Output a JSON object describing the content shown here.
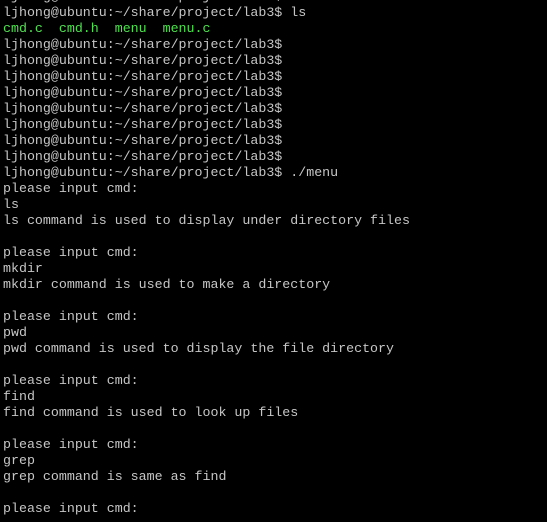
{
  "terminal": {
    "colors": {
      "background": "#000000",
      "text": "#c6c6c6",
      "file_listing": "#4ee04e"
    },
    "lines": [
      {
        "text": "ljhong@ubuntu:~/share/project/lab3$",
        "style": "normal"
      },
      {
        "text": "ljhong@ubuntu:~/share/project/lab3$ ls",
        "style": "normal"
      },
      {
        "text": "cmd.c  cmd.h  menu  menu.c",
        "style": "listing"
      },
      {
        "text": "ljhong@ubuntu:~/share/project/lab3$",
        "style": "normal"
      },
      {
        "text": "ljhong@ubuntu:~/share/project/lab3$",
        "style": "normal"
      },
      {
        "text": "ljhong@ubuntu:~/share/project/lab3$",
        "style": "normal"
      },
      {
        "text": "ljhong@ubuntu:~/share/project/lab3$",
        "style": "normal"
      },
      {
        "text": "ljhong@ubuntu:~/share/project/lab3$",
        "style": "normal"
      },
      {
        "text": "ljhong@ubuntu:~/share/project/lab3$",
        "style": "normal"
      },
      {
        "text": "ljhong@ubuntu:~/share/project/lab3$",
        "style": "normal"
      },
      {
        "text": "ljhong@ubuntu:~/share/project/lab3$",
        "style": "normal"
      },
      {
        "text": "ljhong@ubuntu:~/share/project/lab3$ ./menu",
        "style": "normal"
      },
      {
        "text": "please input cmd:",
        "style": "normal"
      },
      {
        "text": "ls",
        "style": "normal"
      },
      {
        "text": "ls command is used to display under directory files",
        "style": "normal"
      },
      {
        "text": "",
        "style": "normal"
      },
      {
        "text": "please input cmd:",
        "style": "normal"
      },
      {
        "text": "mkdir",
        "style": "normal"
      },
      {
        "text": "mkdir command is used to make a directory",
        "style": "normal"
      },
      {
        "text": "",
        "style": "normal"
      },
      {
        "text": "please input cmd:",
        "style": "normal"
      },
      {
        "text": "pwd",
        "style": "normal"
      },
      {
        "text": "pwd command is used to display the file directory",
        "style": "normal"
      },
      {
        "text": "",
        "style": "normal"
      },
      {
        "text": "please input cmd:",
        "style": "normal"
      },
      {
        "text": "find",
        "style": "normal"
      },
      {
        "text": "find command is used to look up files",
        "style": "normal"
      },
      {
        "text": "",
        "style": "normal"
      },
      {
        "text": "please input cmd:",
        "style": "normal"
      },
      {
        "text": "grep",
        "style": "normal"
      },
      {
        "text": "grep command is same as find",
        "style": "normal"
      },
      {
        "text": "",
        "style": "normal"
      },
      {
        "text": "please input cmd:",
        "style": "normal"
      }
    ]
  }
}
